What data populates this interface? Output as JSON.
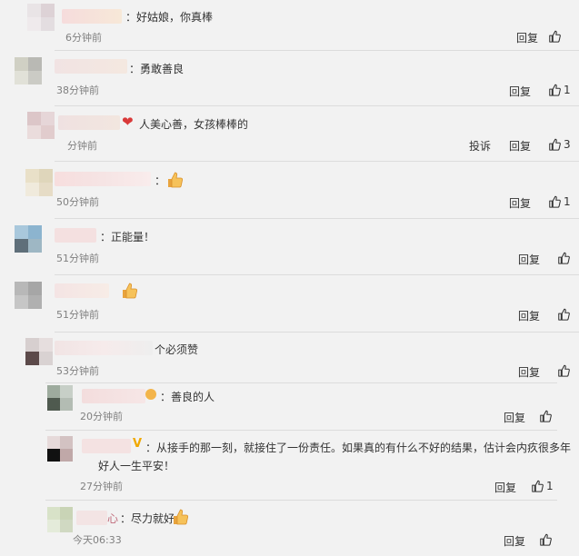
{
  "comments": [
    {
      "text": "：好姑娘，你真棒",
      "time": "6分钟前",
      "reply": "回复",
      "likes": ""
    },
    {
      "text": "：勇敢善良",
      "time": "38分钟前",
      "reply": "回复",
      "likes": "1"
    },
    {
      "text": "人美心善，女孩棒棒的",
      "time": "分钟前",
      "report": "投诉",
      "reply": "回复",
      "likes": "3"
    },
    {
      "text": "：",
      "time": "50分钟前",
      "reply": "回复",
      "likes": "1"
    },
    {
      "text": "：正能量！",
      "time": "51分钟前",
      "reply": "回复",
      "likes": ""
    },
    {
      "text": "",
      "time": "51分钟前",
      "reply": "回复",
      "likes": ""
    },
    {
      "text": "个必须赞",
      "time": "53分钟前",
      "reply": "回复",
      "likes": ""
    }
  ],
  "replies": [
    {
      "text": "：善良的人",
      "time": "20分钟前",
      "reply": "回复",
      "likes": ""
    },
    {
      "text_line1": "：从接手的那一刻，就接住了一份责任。如果真的有什么不好的结果，估计会内疚很多年",
      "text_line2": "好人一生平安！",
      "time": "27分钟前",
      "reply": "回复",
      "likes": "1"
    },
    {
      "name_tail": "心",
      "text": "：尽力就好",
      "time": "今天06:33",
      "reply": "回复",
      "likes": ""
    }
  ],
  "colors": {
    "background": "#f2f2f2",
    "divider": "#dcdcdc",
    "heart": "#d93a3a",
    "v_badge": "#f0a800"
  }
}
